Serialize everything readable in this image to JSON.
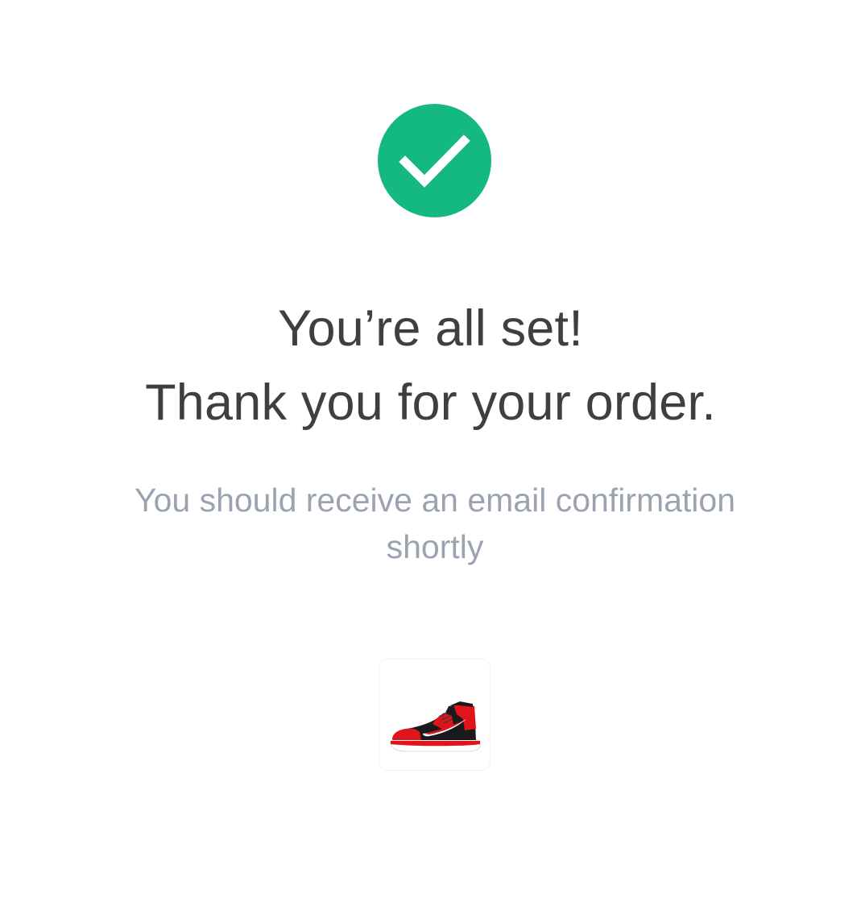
{
  "confirmation": {
    "title_line1": "You’re all set!",
    "title_line2": "Thank you for your order.",
    "subtitle": "You should receive an email confirmation shortly",
    "status_icon": "checkmark-circle-icon",
    "product_image": "sneaker-product-image"
  },
  "colors": {
    "success": "#14b882",
    "heading": "#3f3f42",
    "muted": "#9ba3b0",
    "shoe_red": "#e0141b",
    "shoe_black": "#1a1a1c"
  }
}
